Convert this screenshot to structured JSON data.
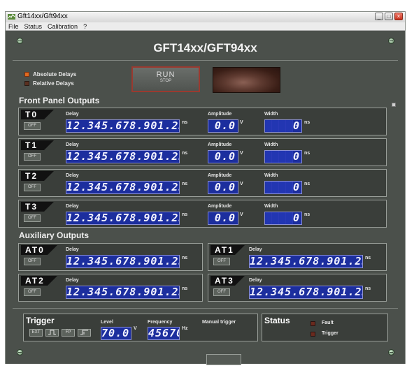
{
  "window": {
    "title": "Gft14xx/Gft94xx",
    "min": "_",
    "max": "□",
    "close": "×"
  },
  "menu": [
    "File",
    "Status",
    "Calibration",
    "?"
  ],
  "app_title": "GFT14xx/GFT94xx",
  "mode": {
    "absolute": "Absolute Delays",
    "relative": "Relative Delays",
    "selected": "absolute"
  },
  "run_button": {
    "line1": "RUN",
    "line2": "STOP"
  },
  "front_panel": {
    "title": "Front Panel Outputs",
    "delay_label": "Delay",
    "amp_label": "Amplitude",
    "width_label": "Width",
    "off_label": "OFF",
    "ns_unit": "ns",
    "v_unit": "V",
    "outputs": [
      {
        "name": "T0",
        "delay": "12.345.678.901.23",
        "amplitude": "0.0",
        "width": "0"
      },
      {
        "name": "T1",
        "delay": "12.345.678.901.23",
        "amplitude": "0.0",
        "width": "0"
      },
      {
        "name": "T2",
        "delay": "12.345.678.901.23",
        "amplitude": "0.0",
        "width": "0"
      },
      {
        "name": "T3",
        "delay": "12.345.678.901.23",
        "amplitude": "0.0",
        "width": "0"
      }
    ]
  },
  "aux": {
    "title": "Auxiliary Outputs",
    "outputs": [
      {
        "name": "AT0",
        "delay": "12.345.678.901.23"
      },
      {
        "name": "AT1",
        "delay": "12.345.678.901.23"
      },
      {
        "name": "AT2",
        "delay": "12.345.678.901.23"
      },
      {
        "name": "AT3",
        "delay": "12.345.678.901.23"
      }
    ]
  },
  "trigger": {
    "title": "Trigger",
    "buttons": [
      "EXT",
      "⊓",
      "FP",
      "⊔"
    ],
    "level_label": "Level",
    "level": "70.0",
    "level_unit": "V",
    "freq_label": "Frequency",
    "freq": "45670",
    "freq_unit": "Hz",
    "manual_label": "Manual trigger"
  },
  "status": {
    "title": "Status",
    "fault": "Fault",
    "trigger": "Trigger"
  },
  "colors": {
    "panel": "#4b504b",
    "lcd": "#1c2e9e",
    "accent": "#e06a20"
  }
}
